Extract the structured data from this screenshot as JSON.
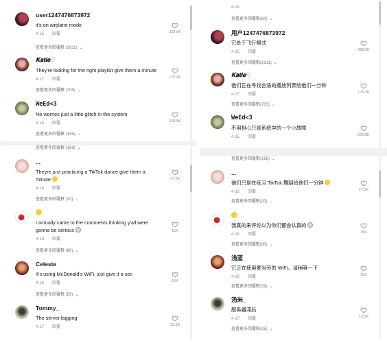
{
  "left_top": {
    "comments": [
      {
        "user": "user1247476873972",
        "text": "it's on airplane mode",
        "date": "4-15",
        "reply": "回覆",
        "likes": "358.6K",
        "more": "查看更多回覆數 (2611)"
      },
      {
        "user": "𝐊𝐚𝐭𝐢𝐞♡",
        "text": "They're looking for the right playlist give them a minute",
        "date": "4-17",
        "reply": "回覆",
        "likes": "175.2K",
        "more": "查看更多回覆數 (705)"
      },
      {
        "user": "WeEd<3",
        "text": "No worries just a little glitch in the system",
        "date": "4-15",
        "reply": "回覆",
        "likes": "200.8K",
        "more": "查看更多回覆數 (185)"
      }
    ]
  },
  "left_bottom": {
    "top_more": "查看更多回覆數 (166)",
    "comments": [
      {
        "user": "...",
        "text": "Theyre just practicing a TikTok dance give them a minute",
        "date": "4-18",
        "reply": "回覆",
        "likes": "17.5K",
        "more": "查看更多回覆數 (20)"
      },
      {
        "user": "",
        "text": "I actually came to the comments thinking y'all were gonna be serious",
        "date": "4-19",
        "reply": "回覆",
        "likes": "15K",
        "more": "查看更多回覆數 (80)"
      },
      {
        "user": "Celeste",
        "text": "It's using McDonald's WiFi, just give it a sec",
        "date": "4-18",
        "reply": "回覆",
        "likes": "15K",
        "more": "查看更多回覆數 (59)"
      },
      {
        "user": "Tommy_",
        "text": "The server lagging",
        "date": "4-17",
        "reply": "回覆",
        "likes": "12.5K",
        "more": ""
      }
    ]
  },
  "right_top": {
    "top_date": "4-15",
    "top_more": "查看更多回覆數(60)",
    "comments": [
      {
        "user": "用户1247476873972",
        "text": "它处于飞行模式",
        "date": "4-15",
        "reply": "回覆",
        "likes": "358.6K",
        "more": "查看更多回覆數(2611)"
      },
      {
        "user": "𝐊𝐚𝐭𝐢𝐞♡",
        "text": "他们正在寻找合适的播放列表给他们一分钟",
        "date": "4-17",
        "reply": "回覆",
        "likes": "175.2K",
        "more": "查看更多回覆數(705)"
      },
      {
        "user": "WeEd<3",
        "text": "不用担心只是系统中的一个小故障",
        "date": "4-15",
        "reply": "回覆",
        "likes": "200.8K",
        "more": ""
      }
    ]
  },
  "right_bottom": {
    "top_more": "查看更多回覆數(166)",
    "comments": [
      {
        "user": "...",
        "text": "他们只是在练习 TikTok 舞蹈给他们一分钟",
        "date": "4-18",
        "reply": "回覆",
        "likes": "17.5K",
        "more": "查看更多回覆數(20)"
      },
      {
        "user": "",
        "text": "我真的来评论以为你们都会认真的",
        "date": "4-19",
        "reply": "回覆",
        "likes": "15K",
        "more": "查看更多回覆數(80)"
      },
      {
        "user": "浅蓝",
        "text": "它正在使用麦当劳的 WiFi，请稍等一下",
        "date": "4-18",
        "reply": "回覆",
        "likes": "15K",
        "more": "查看更多回覆數(59)"
      },
      {
        "user": "汤米_",
        "text": "服务器滞后",
        "date": "4-17",
        "reply": "回覆",
        "likes": "12.5K",
        "more": "查看更多回覆數(25)"
      }
    ]
  },
  "colors": {
    "text": "#161823",
    "muted": "#8a8b91",
    "emoji": "#ffcc33",
    "divider": "#f1f1f2"
  },
  "icons": [
    "heart-icon",
    "chevron-down-icon",
    "smile-emoji-icon",
    "skull-emoji-icon"
  ]
}
